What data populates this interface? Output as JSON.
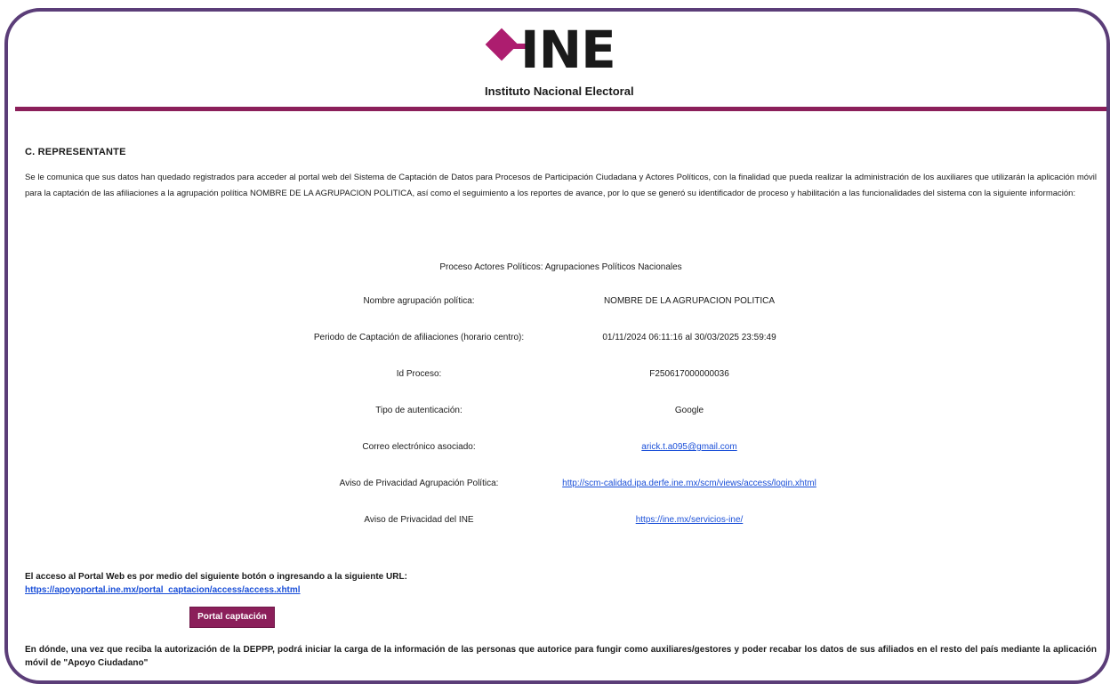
{
  "header": {
    "logo_text": "INE",
    "logo_subtitle": "Instituto Nacional Electoral",
    "brand_color": "#ad1d6f",
    "rule_color": "#8b1f5a"
  },
  "section_title": "C. REPRESENTANTE",
  "intro": "Se le comunica que sus datos han quedado registrados para acceder al portal web del Sistema de Captación de Datos para Procesos de Participación Ciudadana y Actores Políticos, con la finalidad que pueda realizar la administración de los auxiliares que utilizarán la aplicación móvil para la captación de las afiliaciones a la agrupación política NOMBRE DE LA AGRUPACION POLITICA, así como el seguimiento a los reportes de avance, por lo que se generó su identificador de proceso y habilitación a las funcionalidades del sistema con la siguiente información:",
  "proceso": "Proceso Actores Políticos: Agrupaciones Políticos Nacionales",
  "details": [
    {
      "label": "Nombre agrupación política:",
      "value": "NOMBRE DE LA AGRUPACION POLITICA"
    },
    {
      "label": "Periodo de Captación de afiliaciones (horario centro):",
      "value": "01/11/2024 06:11:16 al 30/03/2025 23:59:49"
    },
    {
      "label": "Id Proceso:",
      "value": "F250617000000036"
    },
    {
      "label": "Tipo de autenticación:",
      "value": "Google"
    },
    {
      "label": "Correo electrónico asociado:",
      "value": "arick.t.a095@gmail.com"
    },
    {
      "label": "Aviso de Privacidad Agrupación Política:",
      "value": "http://scm-calidad.ipa.derfe.ine.mx/scm/views/access/login.xhtml"
    },
    {
      "label": "Aviso de Privacidad del INE",
      "value": "https://ine.mx/servicios-ine/"
    }
  ],
  "portal": {
    "label": "El acceso al Portal Web es por medio del siguiente botón o ingresando a la siguiente URL:",
    "url": "https://apoyoportal.ine.mx/portal_captacion/access/access.xhtml",
    "button_label": "Portal captación"
  },
  "footer": "En dónde, una vez que reciba la autorización de la DEPPP, podrá iniciar la carga de la información de las personas que autorice para fungir como auxiliares/gestores y poder recabar los datos de sus afiliados en el resto del país mediante la aplicación móvil de \"Apoyo Ciudadano\""
}
